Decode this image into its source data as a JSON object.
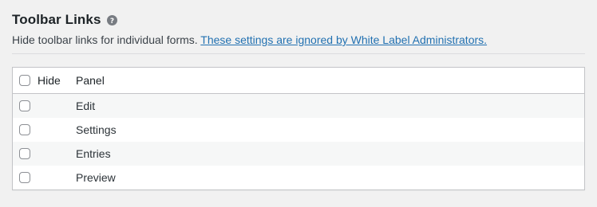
{
  "section": {
    "title": "Toolbar Links",
    "help_icon": "question-circle-icon",
    "description": "Hide toolbar links for individual forms. ",
    "link_text": "These settings are ignored by White Label Administrators."
  },
  "table": {
    "columns": {
      "hide": "Hide",
      "panel": "Panel"
    },
    "rows": [
      {
        "label": "Edit",
        "checked": false
      },
      {
        "label": "Settings",
        "checked": false
      },
      {
        "label": "Entries",
        "checked": false
      },
      {
        "label": "Preview",
        "checked": false
      }
    ]
  },
  "colors": {
    "link": "#2271b1",
    "background": "#f1f1f1",
    "row_alt": "#f6f7f7",
    "border": "#c3c4c7"
  }
}
